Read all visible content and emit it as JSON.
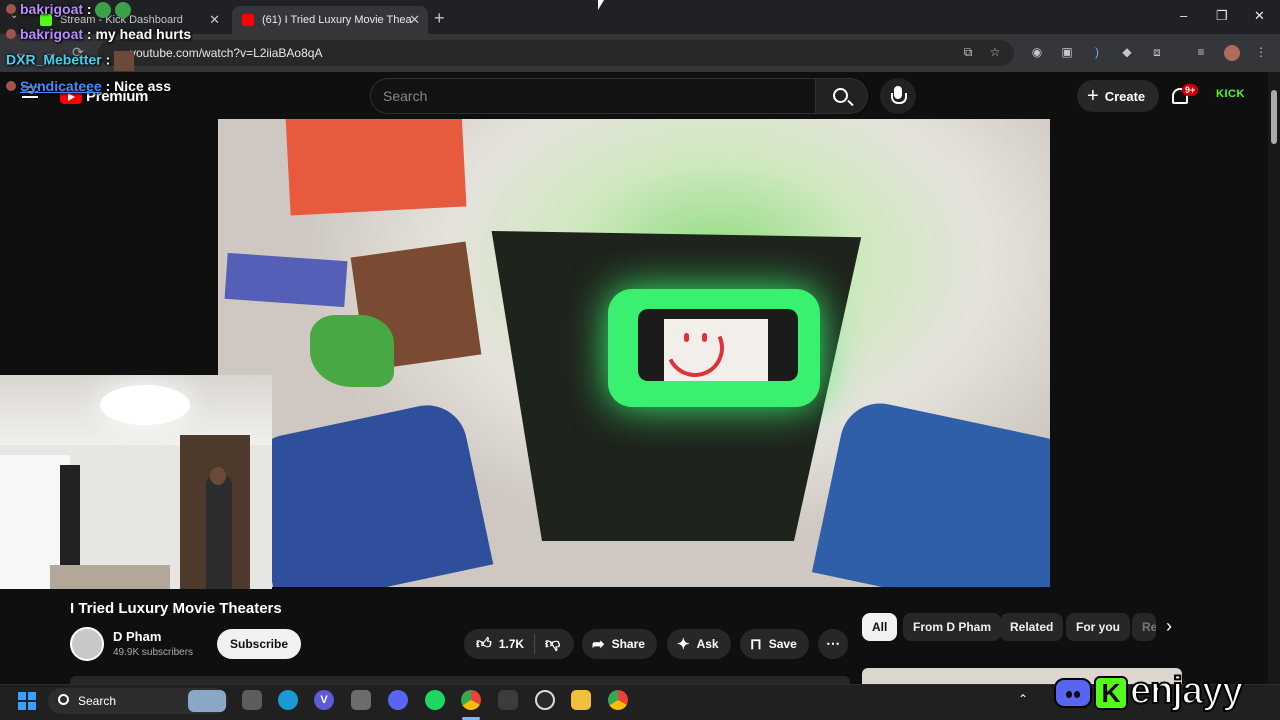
{
  "browser": {
    "tabs": [
      {
        "title": "Stream - Kick Dashboard",
        "favicon": "kick-icon",
        "color": "#53fc18"
      },
      {
        "title": "(61) I Tried Luxury Movie Theate",
        "favicon": "youtube-icon",
        "color": "#ff0000"
      }
    ],
    "new_tab": "+",
    "url": "youtube.com/watch?v=L2iiaBAo8qA",
    "controls": {
      "minimize": "–",
      "maximize": "❐",
      "close": "✕"
    }
  },
  "youtube": {
    "logo_text": "Premium",
    "search_placeholder": "Search",
    "create_label": "Create",
    "notifications_badge": "9+",
    "kick_text": "KICK"
  },
  "video": {
    "title": "I Tried Luxury Movie Theaters",
    "channel": "D Pham",
    "subscribers": "49.9K subscribers",
    "subscribe_label": "Subscribe",
    "likes": "1.7K",
    "share_label": "Share",
    "ask_label": "Ask",
    "save_label": "Save"
  },
  "chips": [
    {
      "label": "All",
      "active": true
    },
    {
      "label": "From D Pham"
    },
    {
      "label": "Related"
    },
    {
      "label": "For you"
    },
    {
      "label": "Re"
    }
  ],
  "chat": [
    {
      "user": "bakrigoat",
      "sep": " : ",
      "message": ""
    },
    {
      "user": "bakrigoat",
      "sep": " : ",
      "message": "my head hurts"
    },
    {
      "user": "DXR_Mebetter",
      "sep": " :",
      "message": ""
    },
    {
      "user": "Syndicateee",
      "sep": " : ",
      "message": "Nice ass"
    }
  ],
  "taskbar": {
    "search_label": "Search",
    "apps": [
      "task-view-icon",
      "edge-icon",
      "vpn-icon",
      "snip-icon",
      "discord-icon",
      "spotify-icon",
      "chrome-icon",
      "calculator-icon",
      "obs-icon",
      "file-explorer-icon",
      "chrome-alt-icon"
    ]
  },
  "overlay": {
    "brand": "enjayy"
  },
  "colors": {
    "yt_red": "#ff0000",
    "kick_green": "#53fc18",
    "discord_blurple": "#5865f2",
    "background": "#0f0f0f"
  }
}
